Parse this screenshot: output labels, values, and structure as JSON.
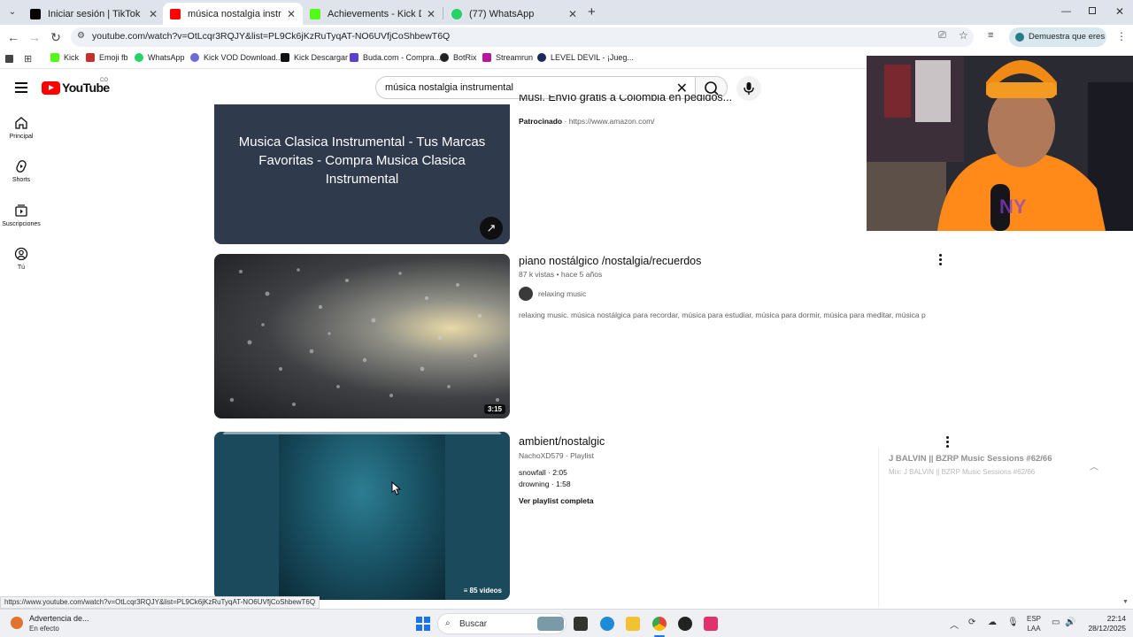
{
  "browser": {
    "tabs": [
      {
        "label": "Iniciar sesión | TikTok",
        "favicon_color": "#000000",
        "active": false
      },
      {
        "label": "música nostalgia instrumental",
        "favicon_color": "#ff0000",
        "active": true
      },
      {
        "label": "Achievements - Kick Dashboard",
        "favicon_color": "#53fc18",
        "active": false
      },
      {
        "label": "(77) WhatsApp",
        "favicon_color": "#25d366",
        "active": false
      }
    ],
    "url": "youtube.com/watch?v=OtLcqr3RQJY&list=PL9Ck6jKzRuTyqAT-NO6UVfjCoShbewT6Q",
    "verify_chip": "Demuestra que eres tú",
    "bookmarks": [
      {
        "label": "Kick",
        "icon_color": "#53fc18"
      },
      {
        "label": "Emoji fb",
        "icon_color": "#c4302b"
      },
      {
        "label": "WhatsApp",
        "icon_color": "#25d366"
      },
      {
        "label": "Kick VOD Download...",
        "icon_color": "#6b6bd6"
      },
      {
        "label": "Kick Descargar",
        "icon_color": "#111111"
      },
      {
        "label": "Buda.com - Compra...",
        "icon_color": "#5b3fd1"
      },
      {
        "label": "BotRix",
        "icon_color": "#222222"
      },
      {
        "label": "Streamrun",
        "icon_color": "#b5179e"
      },
      {
        "label": "LEVEL DEVIL - ¡Jueg...",
        "icon_color": "#1a2a5a"
      }
    ]
  },
  "youtube": {
    "logo_text": "YouTube",
    "country": "CO",
    "search_value": "música nostalgia instrumental",
    "rail": [
      {
        "label": "Principal",
        "icon": "home-icon"
      },
      {
        "label": "Shorts",
        "icon": "shorts-icon"
      },
      {
        "label": "Suscripciones",
        "icon": "subscriptions-icon"
      },
      {
        "label": "Tú",
        "icon": "you-icon"
      }
    ],
    "ad": {
      "title_partial": "Musi. Envío gratis a Colombia en pedidos...",
      "thumb_text": "Musica Clasica Instrumental - Tus Marcas Favoritas - Compra Musica Clasica Instrumental",
      "sponsored": "Patrocinado",
      "sponsored_url": "https://www.amazon.com/"
    },
    "results": [
      {
        "title": "piano nostálgico /nostalgia/recuerdos",
        "views": "87 k vistas",
        "age": "hace 5 años",
        "channel": "relaxing music",
        "snippet": "relaxing music. música nostálgica para recordar, música para estudiar, música para dormir, música para meditar, música para ...",
        "duration": "3:15"
      },
      {
        "title": "ambient/nostalgic",
        "channel_line": "NachoXD579 · Playlist",
        "tracks": [
          "snowfall · 2:05",
          "drowning · 1:58"
        ],
        "view_all": "Ver playlist completa",
        "videos_count": "85 videos"
      }
    ],
    "mini_player": {
      "title": "J BALVIN || BZRP Music Sessions #62/66",
      "subtitle": "Mix: J BALVIN || BZRP Music Sessions #62/66"
    }
  },
  "status_link": "https://www.youtube.com/watch?v=OtLcqr3RQJY&list=PL9Ck6jKzRuTyqAT-NO6UVfjCoShbewT6Q",
  "taskbar": {
    "notification_title": "Advertencia de...",
    "notification_sub": "En efecto",
    "search_placeholder": "Buscar",
    "lang": "ESP",
    "lang_sub": "LAA",
    "time": "22:14",
    "date": "28/12/2025"
  }
}
